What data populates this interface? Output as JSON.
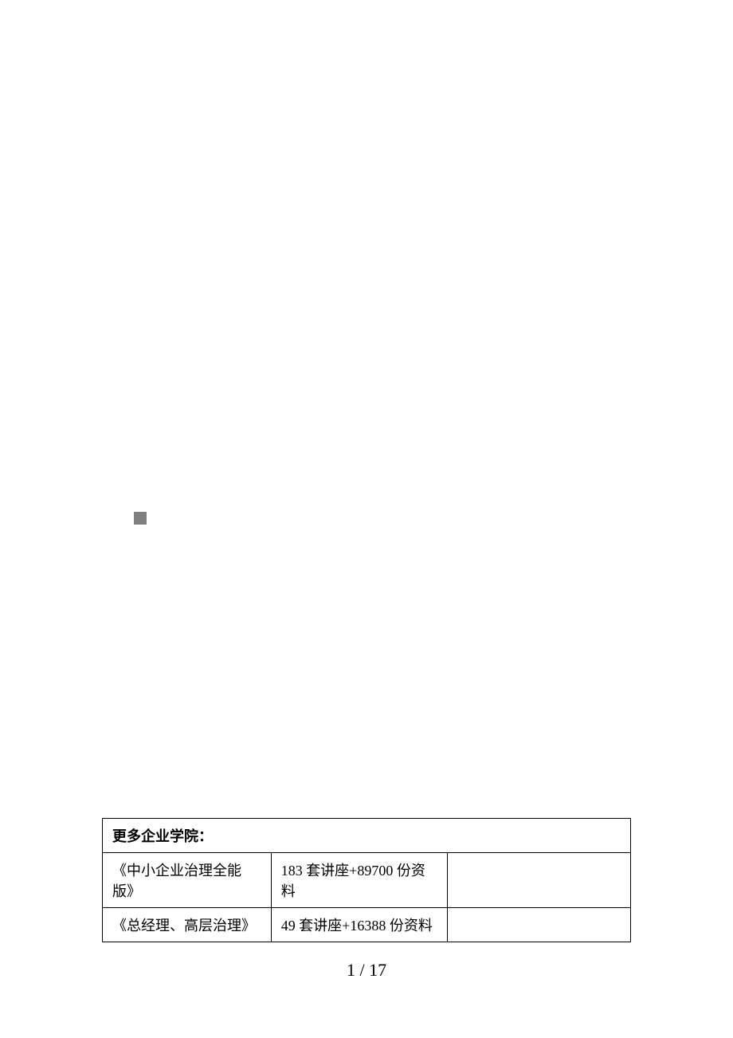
{
  "decorative": {
    "square": true
  },
  "table": {
    "header": "更多企业学院：",
    "rows": [
      {
        "col1": "《中小企业治理全能版》",
        "col2": "183 套讲座+89700 份资料",
        "col3": ""
      },
      {
        "col1": "《总经理、高层治理》",
        "col2": "49 套讲座+16388 份资料",
        "col3": ""
      }
    ]
  },
  "pagination": {
    "current": "1",
    "separator": " / ",
    "total": "17"
  }
}
